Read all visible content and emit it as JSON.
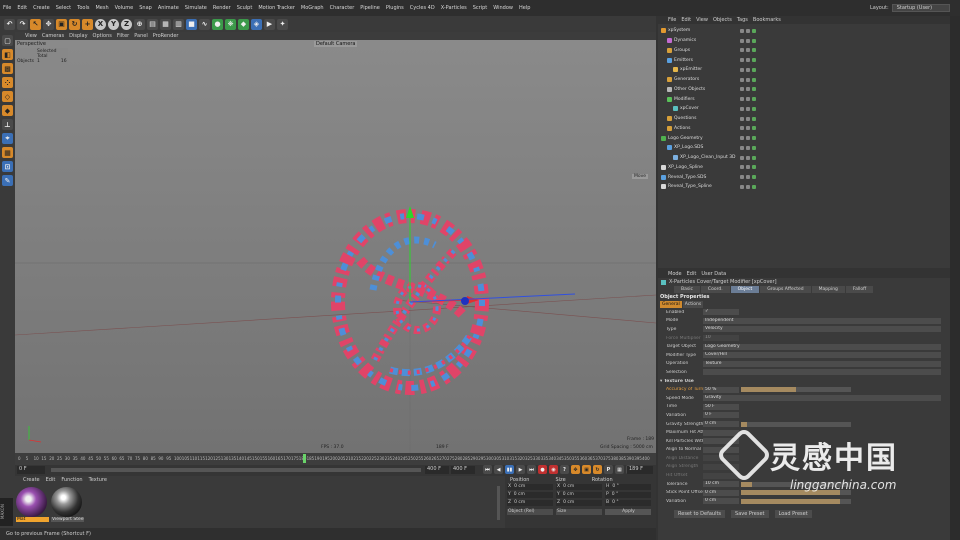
{
  "menubar": [
    "File",
    "Edit",
    "Create",
    "Select",
    "Tools",
    "Mesh",
    "Volume",
    "Snap",
    "Animate",
    "Simulate",
    "Render",
    "Sculpt",
    "Motion Tracker",
    "MoGraph",
    "Character",
    "Pipeline",
    "Plugins",
    "Cycles 4D",
    "X-Particles",
    "Script",
    "Window",
    "Help"
  ],
  "layout": {
    "label": "Layout:",
    "value": "Startup (User)"
  },
  "viewport_menu": [
    "View",
    "Cameras",
    "Display",
    "Options",
    "Filter",
    "Panel",
    "ProRender"
  ],
  "viewport": {
    "name": "Perspective",
    "camera": "Default Camera",
    "hud_header": "Selected Total",
    "hud_label": "Objects",
    "hud_a": "1",
    "hud_b": "16",
    "move": "Move",
    "fps": "FPS : 37.0",
    "frame_center": "189 F",
    "frame": "Frame : 189",
    "grid": "Grid Spacing : 5000 cm"
  },
  "timeline": {
    "ticks": [
      "0",
      "5",
      "10",
      "15",
      "20",
      "25",
      "30",
      "35",
      "40",
      "45",
      "50",
      "55",
      "60",
      "65",
      "70",
      "75",
      "80",
      "85",
      "90",
      "95",
      "100",
      "105",
      "110",
      "115",
      "120",
      "125",
      "130",
      "135",
      "140",
      "145",
      "150",
      "155",
      "160",
      "165",
      "170",
      "175",
      "180",
      "185",
      "190",
      "195",
      "200",
      "205",
      "210",
      "215",
      "220",
      "225",
      "230",
      "235",
      "240",
      "245",
      "250",
      "255",
      "260",
      "265",
      "270",
      "275",
      "280",
      "285",
      "290",
      "295",
      "300",
      "305",
      "310",
      "315",
      "320",
      "325",
      "330",
      "335",
      "340",
      "345",
      "350",
      "355",
      "360",
      "365",
      "370",
      "375",
      "380",
      "385",
      "390",
      "395",
      "400"
    ],
    "cur_frame": "0 F",
    "end_a": "400 F",
    "end_b": "400 F",
    "f_out": "189 F"
  },
  "material_menu": [
    "Create",
    "Edit",
    "Function",
    "Texture"
  ],
  "materials": [
    {
      "name": "Mat"
    },
    {
      "name": "Viewport Steel"
    }
  ],
  "coords": {
    "headers": [
      "Position",
      "Size",
      "Rotation"
    ],
    "rows": [
      [
        "X",
        "0 cm",
        "X",
        "0 cm",
        "H",
        "0 °"
      ],
      [
        "Y",
        "0 cm",
        "Y",
        "0 cm",
        "P",
        "0 °"
      ],
      [
        "Z",
        "0 cm",
        "Z",
        "0 cm",
        "B",
        "0 °"
      ]
    ],
    "mode": "Object (Rel)",
    "size_mode": "Size",
    "apply": "Apply"
  },
  "status": "Go to previous Frame (Shortcut F)",
  "objects_menu": [
    "File",
    "Edit",
    "View",
    "Objects",
    "Tags",
    "Bookmarks"
  ],
  "objects": [
    {
      "name": "xpSystem",
      "depth": 0,
      "color": "#e39a2f"
    },
    {
      "name": "Dynamics",
      "depth": 1,
      "color": "#c36bd1"
    },
    {
      "name": "Groups",
      "depth": 1,
      "color": "#d7a03a"
    },
    {
      "name": "Emitters",
      "depth": 1,
      "color": "#59a0e0"
    },
    {
      "name": "xpEmitter",
      "depth": 2,
      "color": "#e5b64a"
    },
    {
      "name": "Generators",
      "depth": 1,
      "color": "#d7a03a"
    },
    {
      "name": "Other Objects",
      "depth": 1,
      "color": "#b7b7b7"
    },
    {
      "name": "Modifiers",
      "depth": 1,
      "color": "#59c159"
    },
    {
      "name": "xpCover",
      "depth": 2,
      "color": "#5ac0c0"
    },
    {
      "name": "Questions",
      "depth": 1,
      "color": "#d7a03a"
    },
    {
      "name": "Actions",
      "depth": 1,
      "color": "#d7a03a"
    },
    {
      "name": "Logo Geometry",
      "depth": 0,
      "color": "#4fb04f"
    },
    {
      "name": "XP_Logo.SDS",
      "depth": 1,
      "color": "#5aa0e0"
    },
    {
      "name": "XP_Logo_Clean_Input 3D",
      "depth": 2,
      "color": "#7cb0e0"
    },
    {
      "name": "XP_Logo_Spline",
      "depth": 0,
      "color": "#d8d8d8"
    },
    {
      "name": "Reveal_Type.SDS",
      "depth": 0,
      "color": "#5aa0e0"
    },
    {
      "name": "Reveal_Type_Spline",
      "depth": 0,
      "color": "#d8d8d8"
    }
  ],
  "attr_menu": [
    "Mode",
    "Edit",
    "User Data"
  ],
  "attr_title": "X-Particles Cover/Target Modifier [xpCover]",
  "attr_tabs": [
    "Basic",
    "Coord.",
    "Object",
    "Groups Affected",
    "Mapping",
    "Falloff"
  ],
  "attr_section": "Object Properties",
  "attr_subtabs": [
    "General",
    "Actions"
  ],
  "attr_props": [
    {
      "k": "Enabled",
      "v": "✓",
      "w": false
    },
    {
      "k": "Mode",
      "v": "Independent",
      "w": true
    },
    {
      "k": "Type",
      "v": "Velocity",
      "w": true
    },
    {
      "k": "Force Multiplier",
      "v": "10",
      "w": false,
      "dim": true
    },
    {
      "k": "Target Object",
      "v": "Logo Geometry",
      "w": true
    },
    {
      "k": "Modifier Type",
      "v": "Cover/Hill",
      "w": true
    },
    {
      "k": "Operation",
      "v": "Texture",
      "w": true
    },
    {
      "k": "Selection",
      "v": "",
      "w": true
    },
    {
      "k": "▾ Texture Use",
      "v": "",
      "w": false,
      "head": true
    },
    {
      "k": "Accuracy of Turn",
      "v": "50 %",
      "w": false,
      "bar": 0.5,
      "accent": true
    },
    {
      "k": "Speed Mode",
      "v": "Gravity",
      "w": true
    },
    {
      "k": "Time",
      "v": "50 F",
      "w": false
    },
    {
      "k": "Variation",
      "v": "0 F",
      "w": false
    },
    {
      "k": "Gravity Strength",
      "v": "0 cm",
      "w": false,
      "bar": 0.05
    },
    {
      "k": "Maximum Hit Attempts",
      "v": "",
      "w": false
    },
    {
      "k": "Kill Particles Without Target",
      "v": "",
      "w": false
    },
    {
      "k": "Align to Normal",
      "v": "",
      "w": false
    },
    {
      "k": "Align Distance",
      "v": "",
      "w": false,
      "dim": true
    },
    {
      "k": "Align Strength",
      "v": "",
      "w": false,
      "dim": true
    },
    {
      "k": "Hit Offset",
      "v": "",
      "w": false,
      "dim": true
    },
    {
      "k": "Tolerance",
      "v": "10 cm",
      "w": false,
      "bar": 0.1
    },
    {
      "k": "Stick Point Offset",
      "v": "0 cm",
      "w": false,
      "bar": 0.9
    },
    {
      "k": "Variation",
      "v": "0 cm",
      "w": false,
      "bar": 0.9
    }
  ],
  "attr_buttons": [
    "Reset to Defaults",
    "Save Preset",
    "Load Preset"
  ],
  "watermark": {
    "cn": "灵感中国",
    "url": "lingganchina.com"
  }
}
